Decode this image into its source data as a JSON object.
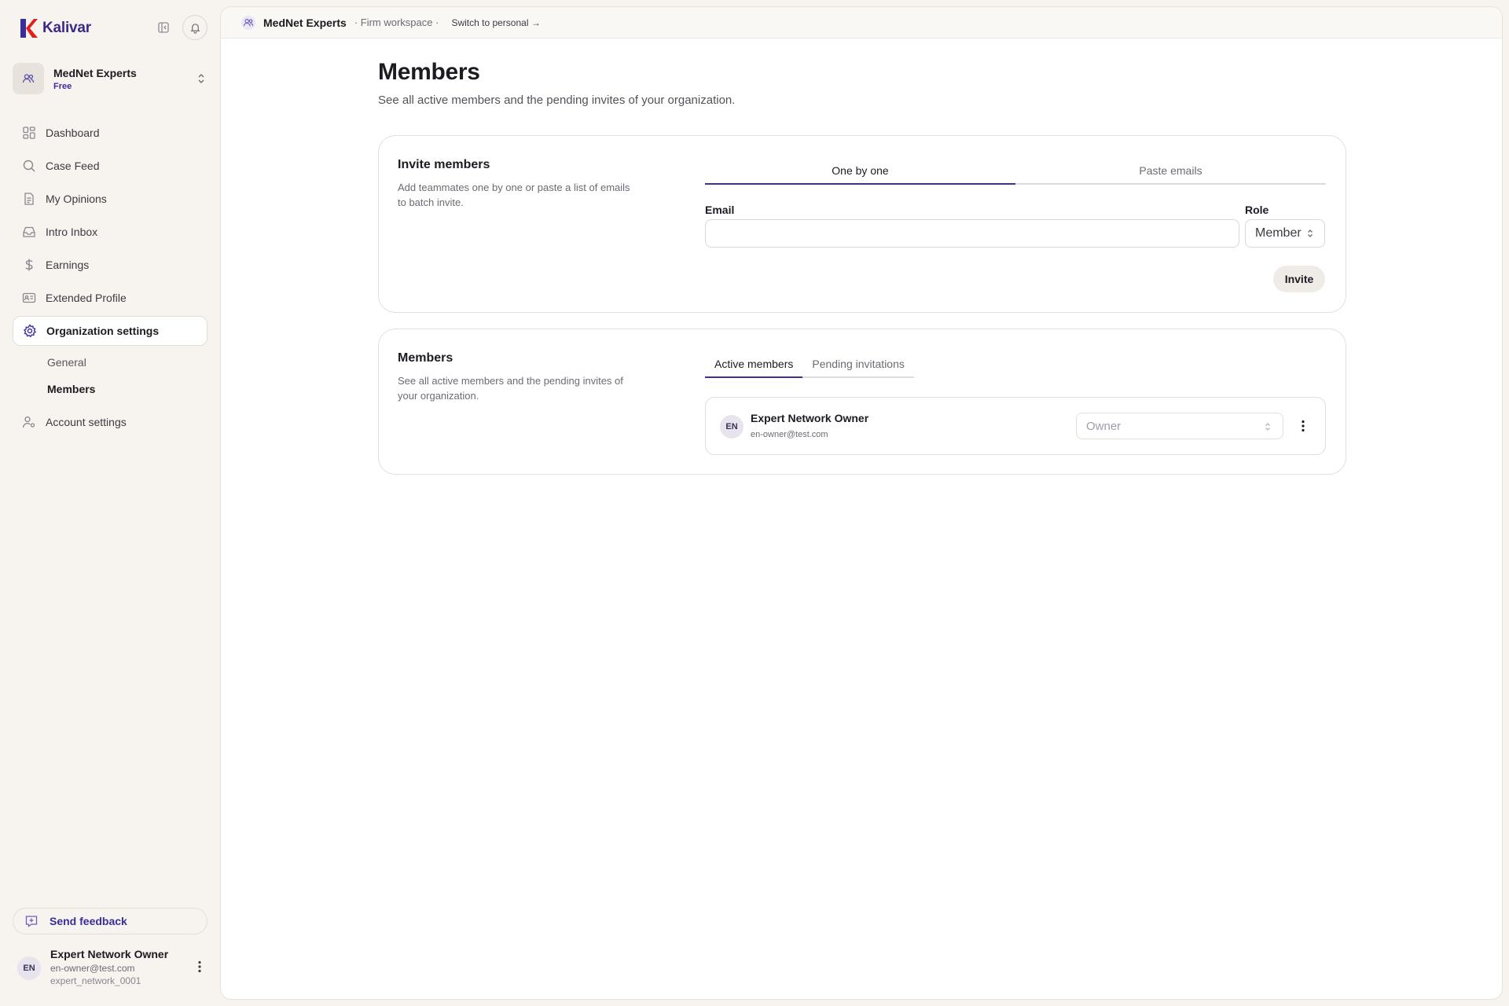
{
  "brand": {
    "name": "Kalivar",
    "accent": "#3c2d9c",
    "logo_red": "#e0211b"
  },
  "org": {
    "name": "MedNet Experts",
    "plan": "Free"
  },
  "nav": {
    "items": [
      {
        "label": "Dashboard",
        "icon": "grid-icon"
      },
      {
        "label": "Case Feed",
        "icon": "search-icon"
      },
      {
        "label": "My Opinions",
        "icon": "document-icon"
      },
      {
        "label": "Intro Inbox",
        "icon": "inbox-icon"
      },
      {
        "label": "Earnings",
        "icon": "dollar-icon"
      },
      {
        "label": "Extended Profile",
        "icon": "id-card-icon"
      },
      {
        "label": "Organization settings",
        "icon": "gear-icon"
      },
      {
        "label": "Account settings",
        "icon": "user-settings-icon"
      }
    ],
    "sub_items": [
      {
        "label": "General"
      },
      {
        "label": "Members"
      }
    ]
  },
  "feedback": {
    "label": "Send feedback"
  },
  "user": {
    "initials": "EN",
    "name": "Expert Network Owner",
    "email": "en-owner@test.com",
    "handle": "expert_network_0001"
  },
  "topbar": {
    "org_name": "MedNet Experts",
    "workspace_kind": "· Firm workspace ·",
    "switch_label": "Switch to personal →"
  },
  "page": {
    "title": "Members",
    "subtitle": "See all active members and the pending invites of your organization."
  },
  "invite": {
    "title": "Invite members",
    "description": "Add teammates one by one or paste a list of emails to batch invite.",
    "tabs": [
      {
        "label": "One by one"
      },
      {
        "label": "Paste emails"
      }
    ],
    "email_label": "Email",
    "email_value": "",
    "role_label": "Role",
    "role_value": "Member",
    "button": "Invite"
  },
  "members": {
    "title": "Members",
    "description": "See all active members and the pending invites of your organization.",
    "tabs": [
      {
        "label": "Active members"
      },
      {
        "label": "Pending invitations"
      }
    ],
    "rows": [
      {
        "initials": "EN",
        "name": "Expert Network Owner",
        "email": "en-owner@test.com",
        "role": "Owner"
      }
    ]
  }
}
